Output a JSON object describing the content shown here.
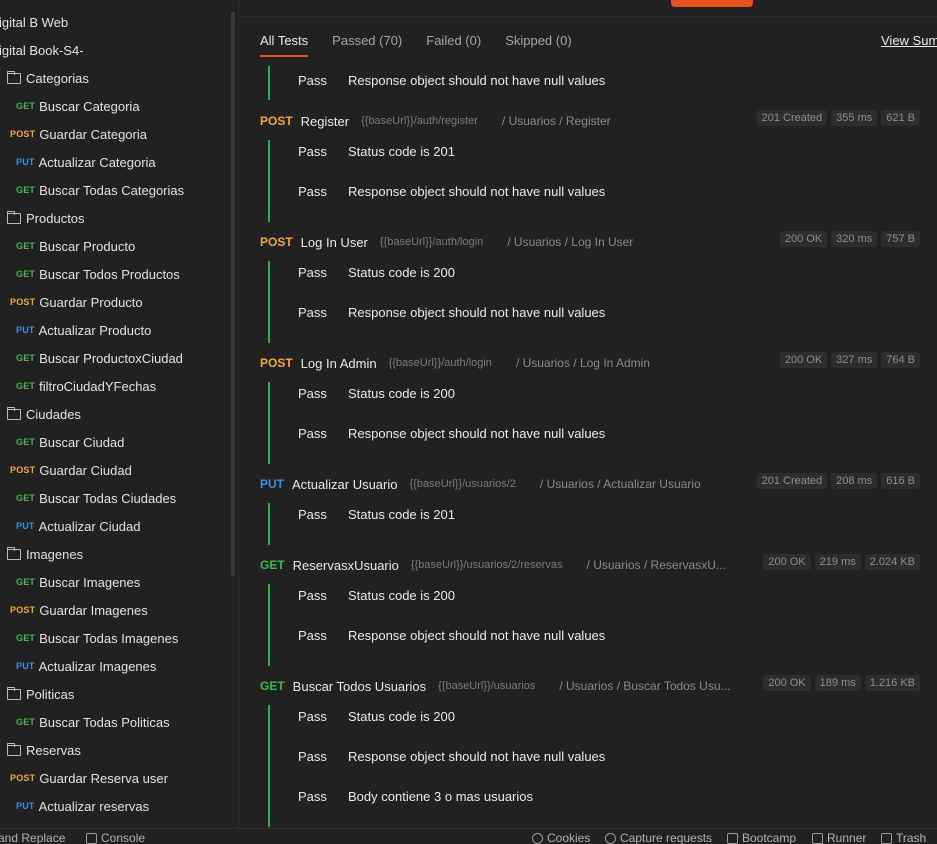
{
  "sidebar": {
    "root_items": [
      "igital B Web",
      "igital Book-S4-"
    ],
    "rows": [
      {
        "type": "folder",
        "label": "Categorias"
      },
      {
        "type": "request",
        "method": "GET",
        "label": "Buscar Categoria"
      },
      {
        "type": "request",
        "method": "POST",
        "label": "Guardar Categoria"
      },
      {
        "type": "request",
        "method": "PUT",
        "label": "Actualizar Categoria"
      },
      {
        "type": "request",
        "method": "GET",
        "label": "Buscar Todas Categorias"
      },
      {
        "type": "folder",
        "label": "Productos"
      },
      {
        "type": "request",
        "method": "GET",
        "label": "Buscar Producto"
      },
      {
        "type": "request",
        "method": "GET",
        "label": "Buscar Todos Productos"
      },
      {
        "type": "request",
        "method": "POST",
        "label": "Guardar Producto"
      },
      {
        "type": "request",
        "method": "PUT",
        "label": "Actualizar Producto"
      },
      {
        "type": "request",
        "method": "GET",
        "label": "Buscar ProductoxCiudad"
      },
      {
        "type": "request",
        "method": "GET",
        "label": "filtroCiudadYFechas"
      },
      {
        "type": "folder",
        "label": "Ciudades"
      },
      {
        "type": "request",
        "method": "GET",
        "label": "Buscar Ciudad"
      },
      {
        "type": "request",
        "method": "POST",
        "label": "Guardar Ciudad"
      },
      {
        "type": "request",
        "method": "GET",
        "label": "Buscar Todas Ciudades"
      },
      {
        "type": "request",
        "method": "PUT",
        "label": "Actualizar Ciudad"
      },
      {
        "type": "folder",
        "label": "Imagenes"
      },
      {
        "type": "request",
        "method": "GET",
        "label": "Buscar Imagenes"
      },
      {
        "type": "request",
        "method": "POST",
        "label": "Guardar Imagenes"
      },
      {
        "type": "request",
        "method": "GET",
        "label": "Buscar Todas Imagenes"
      },
      {
        "type": "request",
        "method": "PUT",
        "label": "Actualizar Imagenes"
      },
      {
        "type": "folder",
        "label": "Politicas"
      },
      {
        "type": "request",
        "method": "GET",
        "label": "Buscar Todas Politicas"
      },
      {
        "type": "folder",
        "label": "Reservas"
      },
      {
        "type": "request",
        "method": "POST",
        "label": "Guardar Reserva user"
      },
      {
        "type": "request",
        "method": "PUT",
        "label": "Actualizar reservas"
      }
    ]
  },
  "tabs": [
    "All Tests",
    "Passed (70)",
    "Failed (0)",
    "Skipped (0)"
  ],
  "active_tab": "All Tests",
  "view_summary": "View Sum",
  "results": {
    "leading_test": {
      "status": "Pass",
      "text": "Response object should not have null values"
    },
    "requests": [
      {
        "method": "POST",
        "name": "Register",
        "url": "{{baseUrl}}/auth/register",
        "path": "/ Usuarios / Register",
        "status": "201 Created",
        "time": "355 ms",
        "size": "621 B",
        "tests": [
          {
            "status": "Pass",
            "text": "Status code is 201"
          },
          {
            "status": "Pass",
            "text": "Response object should not have null values"
          }
        ]
      },
      {
        "method": "POST",
        "name": "Log In User",
        "url": "{{baseUrl}}/auth/login",
        "path": "/ Usuarios / Log In User",
        "status": "200 OK",
        "time": "320 ms",
        "size": "757 B",
        "tests": [
          {
            "status": "Pass",
            "text": "Status code is 200"
          },
          {
            "status": "Pass",
            "text": "Response object should not have null values"
          }
        ]
      },
      {
        "method": "POST",
        "name": "Log In Admin",
        "url": "{{baseUrl}}/auth/login",
        "path": "/ Usuarios / Log In Admin",
        "status": "200 OK",
        "time": "327 ms",
        "size": "764 B",
        "tests": [
          {
            "status": "Pass",
            "text": "Status code is 200"
          },
          {
            "status": "Pass",
            "text": "Response object should not have null values"
          }
        ]
      },
      {
        "method": "PUT",
        "name": "Actualizar Usuario",
        "url": "{{baseUrl}}/usuarios/2",
        "path": "/ Usuarios / Actualizar Usuario",
        "status": "201 Created",
        "time": "208 ms",
        "size": "616 B",
        "tests": [
          {
            "status": "Pass",
            "text": "Status code is 201"
          }
        ]
      },
      {
        "method": "GET",
        "name": "ReservasxUsuario",
        "url": "{{baseUrl}}/usuarios/2/reservas",
        "path": "/ Usuarios / ReservasxU...",
        "status": "200 OK",
        "time": "219 ms",
        "size": "2.024 KB",
        "tests": [
          {
            "status": "Pass",
            "text": "Status code is 200"
          },
          {
            "status": "Pass",
            "text": "Response object should not have null values"
          }
        ]
      },
      {
        "method": "GET",
        "name": "Buscar Todos Usuarios",
        "url": "{{baseUrl}}/usuarios",
        "path": "/ Usuarios / Buscar Todos Usu...",
        "status": "200 OK",
        "time": "189 ms",
        "size": "1.216 KB",
        "tests": [
          {
            "status": "Pass",
            "text": "Status code is 200"
          },
          {
            "status": "Pass",
            "text": "Response object should not have null values"
          },
          {
            "status": "Pass",
            "text": "Body contiene 3 o mas usuarios"
          }
        ]
      }
    ]
  },
  "statusbar": {
    "find_replace": "and Replace",
    "console": "Console",
    "cookies": "Cookies",
    "capture": "Capture requests",
    "bootcamp": "Bootcamp",
    "runner": "Runner",
    "trash": "Trash"
  },
  "colors": {
    "accent": "#e8501e",
    "get": "#3fb950",
    "post": "#f2a93b",
    "put": "#3a8fe6",
    "pass_bar": "#22b14c"
  }
}
